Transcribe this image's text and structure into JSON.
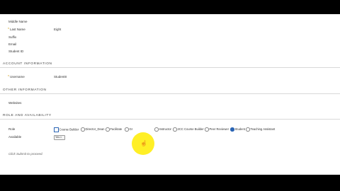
{
  "personal": {
    "fields": [
      {
        "label": "Middle Name",
        "value": "",
        "required": false
      },
      {
        "label": "Last Name",
        "value": "Eight",
        "required": true
      },
      {
        "label": "Suffix",
        "value": "",
        "required": false
      },
      {
        "label": "Email",
        "value": "",
        "required": false
      },
      {
        "label": "Student ID",
        "value": "",
        "required": false
      }
    ]
  },
  "account": {
    "heading": "ACCOUNT INFORMATION",
    "username_label": "Username",
    "username_value": "Student8",
    "required_marker": "*"
  },
  "other": {
    "heading": "OTHER INFORMATION",
    "websites_label": "Websites"
  },
  "roles": {
    "heading": "ROLE AND AVAILABILITY",
    "role_label": "Role",
    "options": [
      "Course Builder",
      "Director_Dean",
      "Facilitate",
      "Gr",
      "Instructor",
      "2CC Course Builder",
      "Peer Reviewer",
      "Student",
      "Teaching Assistant"
    ],
    "selected": "Student",
    "available_label": "Available",
    "available_value": "Yes"
  },
  "instruction": "Click Submit to proceed.",
  "accent_color": "#2a64b4",
  "highlight_color": "#ffec00",
  "cursor_icon": "hand-pointer-icon"
}
